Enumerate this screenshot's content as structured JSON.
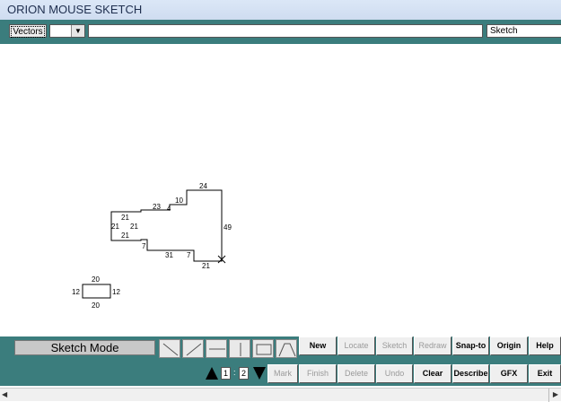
{
  "window": {
    "title": "ORION MOUSE SKETCH"
  },
  "topbar": {
    "vectors_label": "Vectors",
    "combo_value": "",
    "command_value": "",
    "mode_field": "Sketch"
  },
  "sketch": {
    "labels": {
      "top": "24",
      "right": "49",
      "upper_left": "23",
      "step_a": "4",
      "step_b": "10",
      "box_top": "21",
      "box_left": "21",
      "box_right": "21",
      "box_bottom": "21",
      "small_left": "7",
      "lower_mid": "31",
      "small_mid": "7",
      "bottom": "21"
    },
    "small_rect": {
      "top": "20",
      "left": "12",
      "right": "12",
      "bottom": "20"
    }
  },
  "toolbar1": {
    "mode_label": "Sketch Mode",
    "shape_icons": [
      "diagonal-down-line-icon",
      "diagonal-up-line-icon",
      "horizontal-line-icon",
      "vertical-line-icon",
      "rectangle-icon",
      "peak-icon"
    ],
    "buttons": {
      "new": "New",
      "locate": "Locate",
      "sketch": "Sketch",
      "redraw": "Redraw",
      "snap_to": "Snap-to",
      "origin": "Origin",
      "help": "Help"
    }
  },
  "toolbar2": {
    "page_a": "1",
    "colon": ":",
    "page_b": "2",
    "buttons": {
      "mark": "Mark",
      "finish": "Finish",
      "delete": "Delete",
      "undo": "Undo",
      "clear": "Clear",
      "describe": "Describe",
      "gfx": "GFX",
      "exit": "Exit"
    }
  },
  "scrollbar": {
    "left_arrow": "◀",
    "right_arrow": "▶"
  },
  "colors": {
    "teal": "#3b7d7d",
    "titlebar": "#dbe7f7"
  }
}
